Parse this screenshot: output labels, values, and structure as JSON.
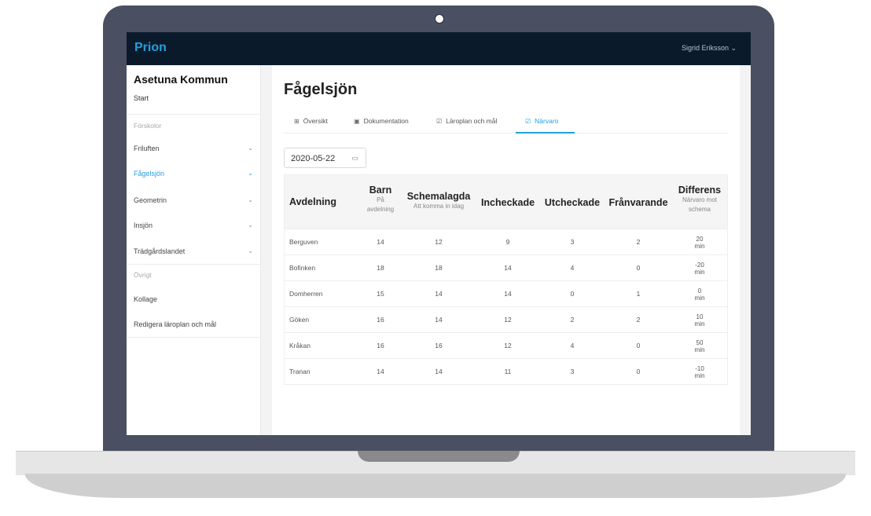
{
  "app": {
    "brand": "Prion",
    "user_menu": "Sigrid Eriksson ⌄"
  },
  "sidebar": {
    "org": "Asetuna Kommun",
    "start": "Start",
    "section_forskolor": "Förskolor",
    "items": [
      {
        "label": "Friluften",
        "chevron": "⌄"
      },
      {
        "label": "Fågelsjön",
        "chevron": "⌄"
      },
      {
        "label": "Geometrin",
        "chevron": "⌄"
      },
      {
        "label": "Insjön",
        "chevron": "⌄"
      },
      {
        "label": "Trädgårdslandet",
        "chevron": "⌄"
      }
    ],
    "section_ovrigt": "Övrigt",
    "other": [
      {
        "label": "Kollage"
      },
      {
        "label": "Redigera läroplan och mål"
      }
    ]
  },
  "page": {
    "title": "Fågelsjön",
    "tabs": [
      {
        "label": "Översikt",
        "icon": "⊞"
      },
      {
        "label": "Dokumentation",
        "icon": "▣"
      },
      {
        "label": "Läroplan och mål",
        "icon": "☑"
      },
      {
        "label": "Närvaro",
        "icon": "☑"
      }
    ],
    "date": "2020-05-22",
    "calendar_icon": "▭"
  },
  "table": {
    "headers": [
      {
        "main": "Avdelning",
        "sub": ""
      },
      {
        "main": "Barn",
        "sub": "På avdelning"
      },
      {
        "main": "Schemalagda",
        "sub": "Att komma in idag"
      },
      {
        "main": "Incheckade",
        "sub": ""
      },
      {
        "main": "Utcheckade",
        "sub": ""
      },
      {
        "main": "Frånvarande",
        "sub": ""
      },
      {
        "main": "Differens",
        "sub": "Närvaro mot schema"
      }
    ],
    "rows": [
      {
        "name": "Berguven",
        "barn": "14",
        "schemalagda": "12",
        "incheckade": "9",
        "utcheckade": "3",
        "franvarande": "2",
        "diff": "20",
        "unit": "min"
      },
      {
        "name": "Bofinken",
        "barn": "18",
        "schemalagda": "18",
        "incheckade": "14",
        "utcheckade": "4",
        "franvarande": "0",
        "diff": "-20",
        "unit": "min"
      },
      {
        "name": "Domherren",
        "barn": "15",
        "schemalagda": "14",
        "incheckade": "14",
        "utcheckade": "0",
        "franvarande": "1",
        "diff": "0",
        "unit": "min"
      },
      {
        "name": "Göken",
        "barn": "16",
        "schemalagda": "14",
        "incheckade": "12",
        "utcheckade": "2",
        "franvarande": "2",
        "diff": "10",
        "unit": "min"
      },
      {
        "name": "Kråkan",
        "barn": "16",
        "schemalagda": "16",
        "incheckade": "12",
        "utcheckade": "4",
        "franvarande": "0",
        "diff": "50",
        "unit": "min"
      },
      {
        "name": "Tranan",
        "barn": "14",
        "schemalagda": "14",
        "incheckade": "11",
        "utcheckade": "3",
        "franvarande": "0",
        "diff": "-10",
        "unit": "min"
      }
    ]
  }
}
